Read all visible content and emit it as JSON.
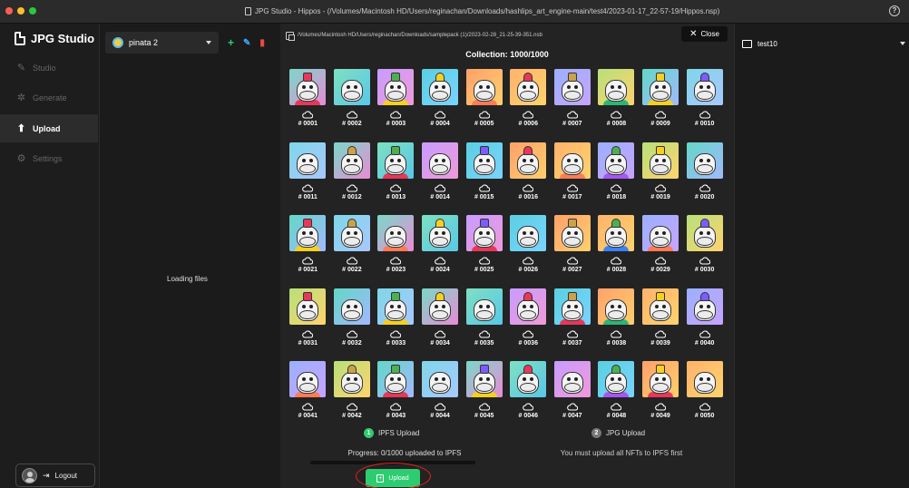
{
  "window": {
    "title": "JPG Studio - Hippos - (/Volumes/Macintosh HD/Users/reginachan/Downloads/hashlips_art_engine-main/test4/2023-01-17_22-57-19/Hippos.nsp)",
    "help_label": "?"
  },
  "sidebar": {
    "brand": "JPG Studio",
    "items": [
      {
        "label": "Studio",
        "icon": "brush-icon",
        "active": false
      },
      {
        "label": "Generate",
        "icon": "sparkle-icon",
        "active": false
      },
      {
        "label": "Upload",
        "icon": "upload-icon",
        "active": true
      },
      {
        "label": "Settings",
        "icon": "gear-icon",
        "active": false
      }
    ],
    "logout_label": "Logout"
  },
  "project": {
    "selected": "pinata 2",
    "loading_text": "Loading files"
  },
  "main": {
    "path": "/Volumes/Macintosh HD/Users/reginachan/Downloads/samplepack (1)/2023-02-28_21-25-39-351.nsb",
    "close_label": "Close",
    "collection_label": "Collection: 1000/1000",
    "items": [
      "# 0001",
      "# 0002",
      "# 0003",
      "# 0004",
      "# 0005",
      "# 0006",
      "# 0007",
      "# 0008",
      "# 0009",
      "# 0010",
      "# 0011",
      "# 0012",
      "# 0013",
      "# 0014",
      "# 0015",
      "# 0016",
      "# 0017",
      "# 0018",
      "# 0019",
      "# 0020",
      "# 0021",
      "# 0022",
      "# 0023",
      "# 0024",
      "# 0025",
      "# 0026",
      "# 0027",
      "# 0028",
      "# 0029",
      "# 0030",
      "# 0031",
      "# 0032",
      "# 0033",
      "# 0034",
      "# 0035",
      "# 0036",
      "# 0037",
      "# 0038",
      "# 0039",
      "# 0040",
      "# 0041",
      "# 0042",
      "# 0043",
      "# 0044",
      "# 0045",
      "# 0046",
      "# 0047",
      "# 0048",
      "# 0049",
      "# 0050"
    ],
    "tile_colors": [
      [
        "#7ad8c8",
        "#e98bd6"
      ],
      [
        "#5ad0e0",
        "#7ad3ff"
      ],
      [
        "#9bb0ff",
        "#c6a4ff"
      ],
      [
        "#7fd6e8",
        "#a8c8ff"
      ],
      [
        "#c79cff",
        "#f09ad8"
      ],
      [
        "#ffb26b",
        "#ffd36e"
      ],
      [
        "#62d7c6",
        "#a3b8ff"
      ],
      [
        "#7ee0c0",
        "#59c7e8"
      ],
      [
        "#ffa06b",
        "#ffd06b"
      ],
      [
        "#b7e07a",
        "#ffd36e"
      ]
    ]
  },
  "steps": {
    "ipfs": {
      "number": "1",
      "label": "IPFS Upload"
    },
    "jpg": {
      "number": "2",
      "label": "JPG Upload"
    },
    "progress_text": "Progress: 0/1000 uploaded to IPFS",
    "progress_fraction": 0,
    "must_text": "You must upload all NFTs to IPFS first",
    "upload_label": "Upload"
  },
  "right": {
    "selected": "test10"
  },
  "colors": {
    "accent_green": "#2ecc71",
    "annotation_red": "#e2231a",
    "edit_blue": "#3aa8ff",
    "delete_red": "#e74c3c"
  }
}
